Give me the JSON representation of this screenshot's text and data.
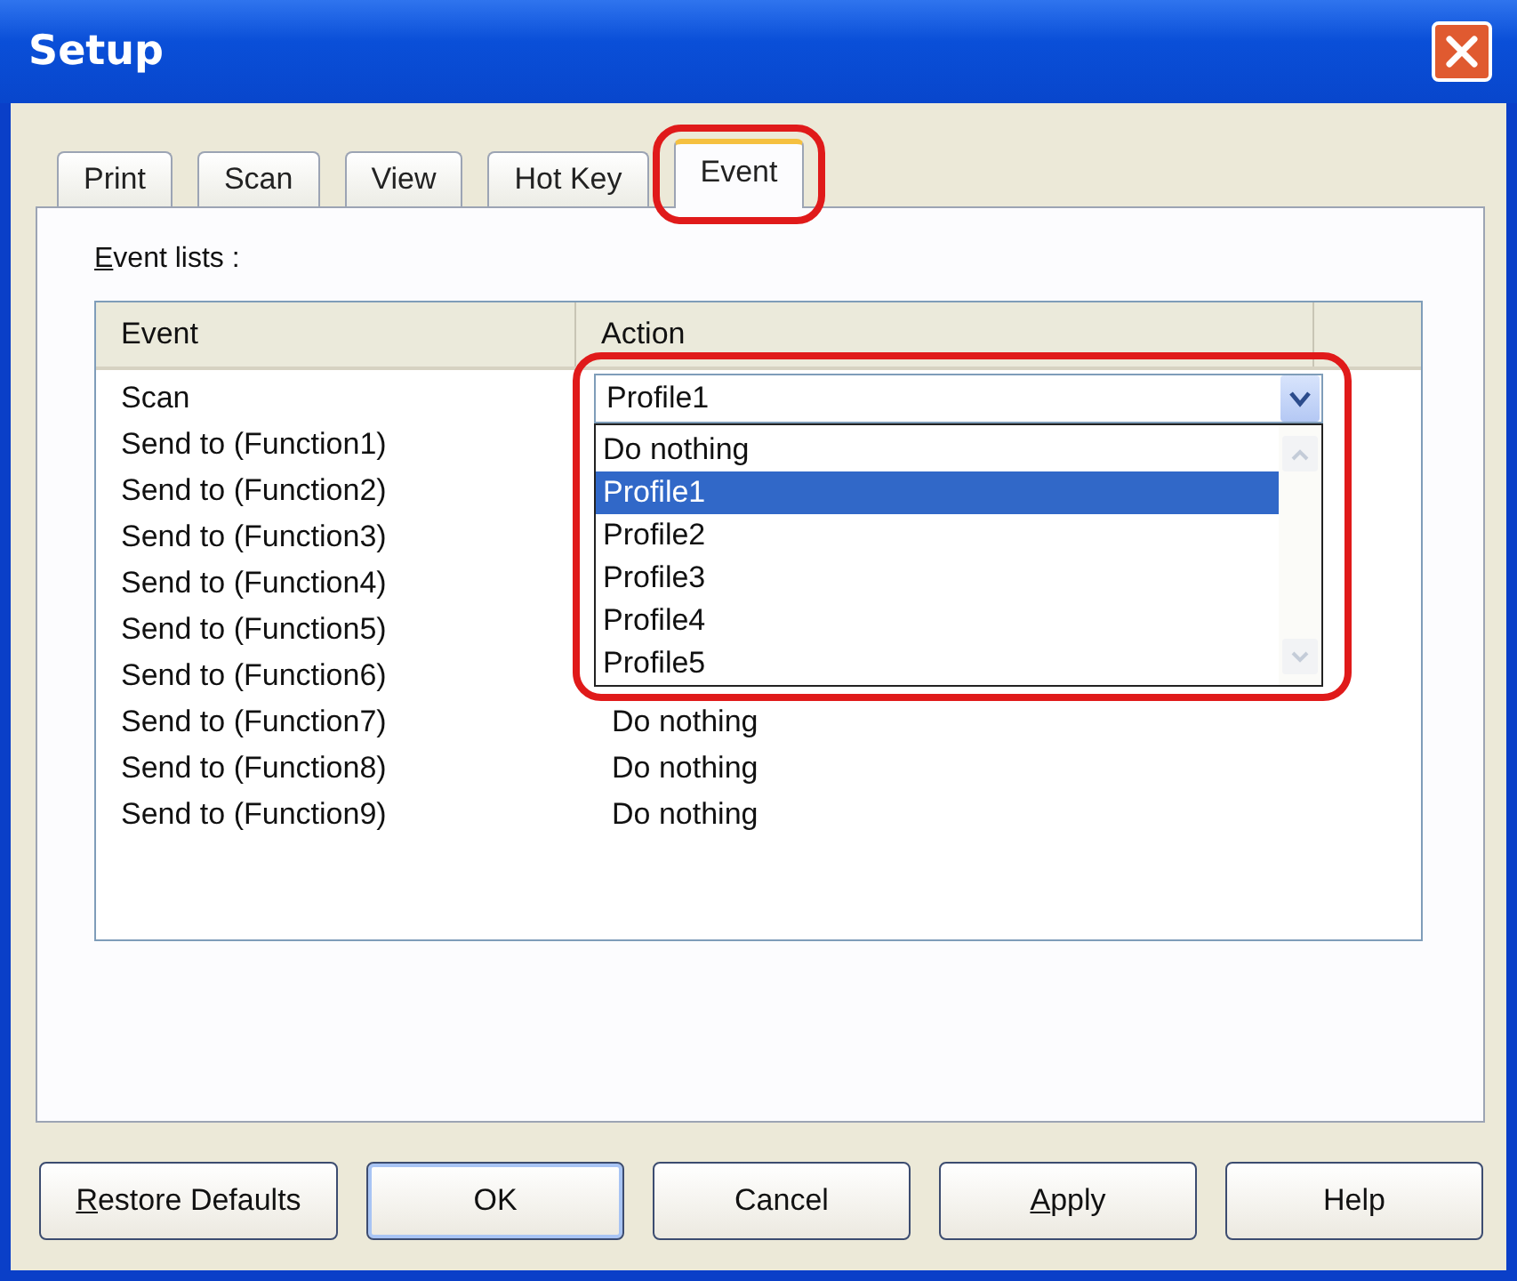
{
  "window": {
    "title": "Setup"
  },
  "tabs": [
    {
      "label": "Print",
      "selected": false,
      "highlighted": false
    },
    {
      "label": "Scan",
      "selected": false,
      "highlighted": false
    },
    {
      "label": "View",
      "selected": false,
      "highlighted": false
    },
    {
      "label": "Hot Key",
      "selected": false,
      "highlighted": false
    },
    {
      "label": "Event",
      "selected": true,
      "highlighted": true
    }
  ],
  "group_label": {
    "text": "Event lists :",
    "mnemonic": true
  },
  "table": {
    "columns": [
      "Event",
      "Action"
    ],
    "rows": [
      {
        "event": "Scan",
        "combo": {
          "value": "Profile1",
          "expanded": true,
          "highlighted": true,
          "options": [
            {
              "label": "Do nothing",
              "selected": false
            },
            {
              "label": "Profile1",
              "selected": true
            },
            {
              "label": "Profile2",
              "selected": false
            },
            {
              "label": "Profile3",
              "selected": false
            },
            {
              "label": "Profile4",
              "selected": false
            },
            {
              "label": "Profile5",
              "selected": false
            }
          ]
        }
      },
      {
        "event": "Send to (Function1)"
      },
      {
        "event": "Send to (Function2)"
      },
      {
        "event": "Send to (Function3)"
      },
      {
        "event": "Send to (Function4)"
      },
      {
        "event": "Send to (Function5)"
      },
      {
        "event": "Send to (Function6)"
      },
      {
        "event": "Send to (Function7)",
        "action": "Do nothing"
      },
      {
        "event": "Send to (Function8)",
        "action": "Do nothing"
      },
      {
        "event": "Send to (Function9)",
        "action": "Do nothing"
      }
    ]
  },
  "buttons": [
    {
      "label": "Restore Defaults",
      "mnemonic": true,
      "default": false
    },
    {
      "label": "OK",
      "mnemonic": false,
      "default": true
    },
    {
      "label": "Cancel",
      "mnemonic": false,
      "default": false
    },
    {
      "label": "Apply",
      "mnemonic": true,
      "default": false
    },
    {
      "label": "Help",
      "mnemonic": false,
      "default": false
    }
  ]
}
